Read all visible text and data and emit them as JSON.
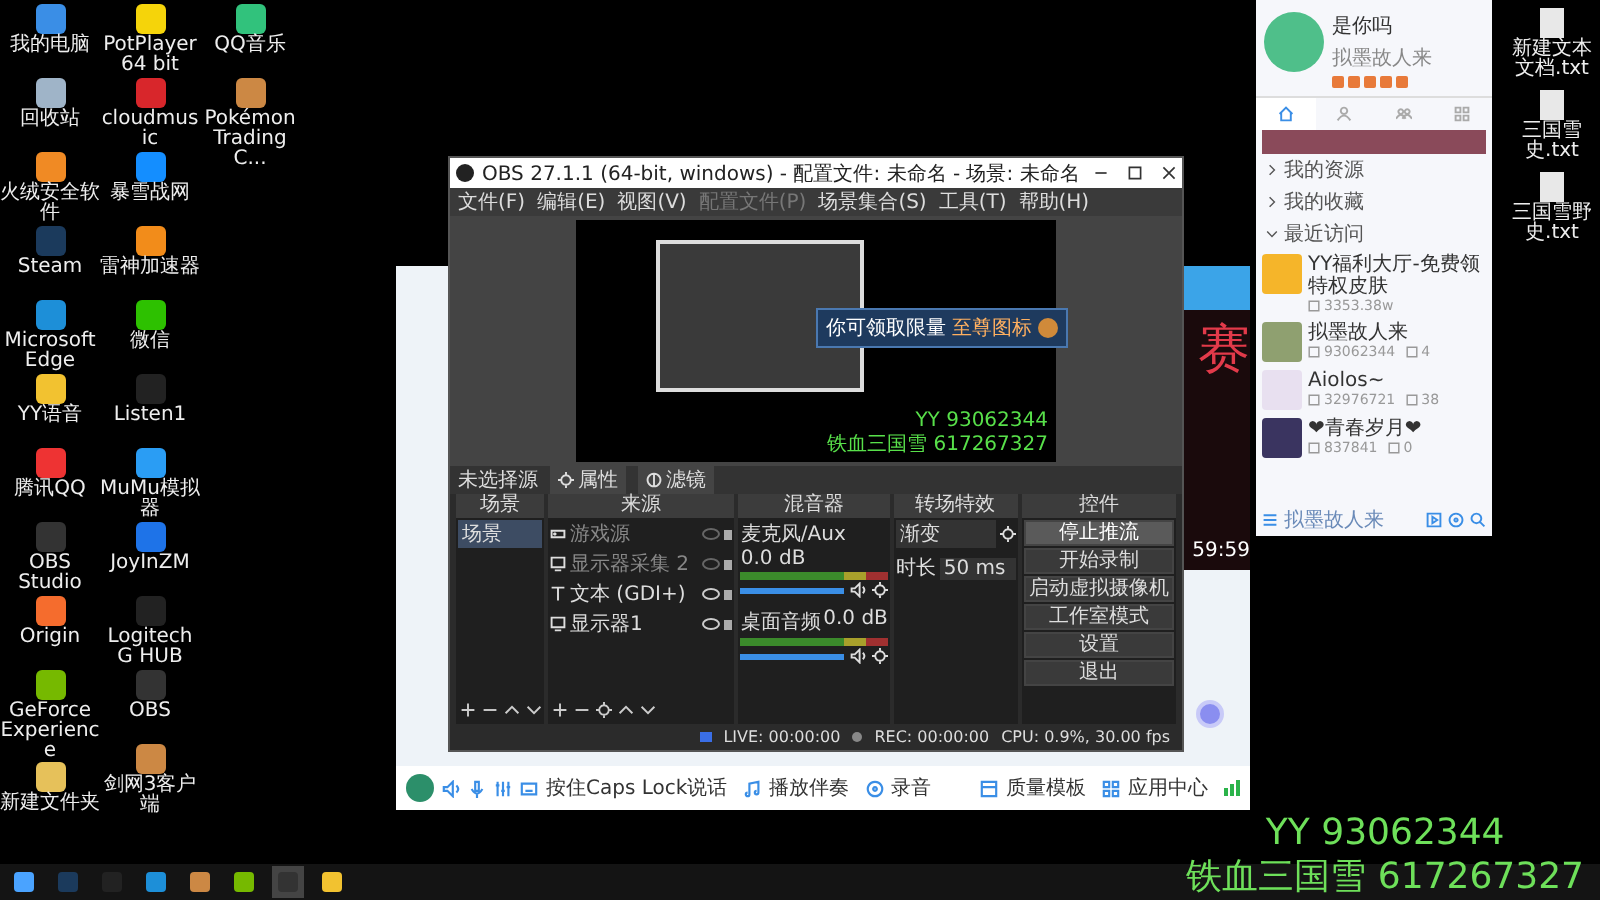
{
  "desktop": {
    "columns": [
      [
        {
          "label": "我的电脑",
          "kind": "computer"
        },
        {
          "label": "回收站",
          "kind": "trash"
        },
        {
          "label": "火绒安全软件",
          "kind": "shield"
        },
        {
          "label": "Steam",
          "kind": "steam"
        },
        {
          "label": "Microsoft Edge",
          "kind": "edge"
        },
        {
          "label": "YY语音",
          "kind": "yy"
        },
        {
          "label": "腾讯QQ",
          "kind": "qq"
        },
        {
          "label": "OBS Studio",
          "kind": "obs"
        },
        {
          "label": "Origin",
          "kind": "origin"
        },
        {
          "label": "GeForce Experience",
          "kind": "nvidia"
        },
        {
          "label": "新建文件夹",
          "kind": "folder"
        }
      ],
      [
        {
          "label": "PotPlayer 64 bit",
          "kind": "player"
        },
        {
          "label": "cloudmusic",
          "kind": "music"
        },
        {
          "label": "暴雪战网",
          "kind": "battlenet"
        },
        {
          "label": "雷神加速器",
          "kind": "boost"
        },
        {
          "label": "微信",
          "kind": "wechat"
        },
        {
          "label": "Listen1",
          "kind": "listen"
        },
        {
          "label": "MuMu模拟器",
          "kind": "mumu"
        },
        {
          "label": "JoyInZM",
          "kind": "gear"
        },
        {
          "label": "Logitech G HUB",
          "kind": "logitech"
        },
        {
          "label": "OBS",
          "kind": "obs"
        },
        {
          "label": "剑网3客户端",
          "kind": "game"
        }
      ],
      [
        {
          "label": "QQ音乐",
          "kind": "qqmusic"
        },
        {
          "label": "Pokémon Trading C...",
          "kind": "game"
        }
      ]
    ],
    "files": [
      {
        "label": "新建文本文档.txt"
      },
      {
        "label": "三国雪史.txt"
      },
      {
        "label": "三国雪野史.txt"
      }
    ]
  },
  "yy_window": {
    "big_char": "赛",
    "timer": "59:59",
    "toolbar": [
      {
        "label": "按住Caps Lock说话",
        "kind": "keyboard"
      },
      {
        "label": "播放伴奏",
        "kind": "music"
      },
      {
        "label": "录音",
        "kind": "record"
      }
    ],
    "toolbar_right": [
      {
        "label": "质量模板",
        "kind": "template"
      },
      {
        "label": "应用中心",
        "kind": "apps"
      }
    ]
  },
  "obs": {
    "title": "OBS 27.1.1 (64-bit, windows) - 配置文件: 未命名 - 场景: 未命名",
    "menu": [
      {
        "label": "文件(F)",
        "disabled": false
      },
      {
        "label": "编辑(E)",
        "disabled": false
      },
      {
        "label": "视图(V)",
        "disabled": false
      },
      {
        "label": "配置文件(P)",
        "disabled": true
      },
      {
        "label": "场景集合(S)",
        "disabled": false
      },
      {
        "label": "工具(T)",
        "disabled": false
      },
      {
        "label": "帮助(H)",
        "disabled": false
      }
    ],
    "preview": {
      "popup_text": "你可领取限量",
      "popup_highlight": "至尊图标",
      "yy_id": "YY 93062344",
      "caption": "铁血三国雪 617267327"
    },
    "source_toolbar": {
      "label": "未选择源",
      "buttons": [
        {
          "label": "属性",
          "kind": "gear"
        },
        {
          "label": "滤镜",
          "kind": "filter"
        }
      ]
    },
    "scenes": {
      "title": "场景",
      "items": [
        {
          "label": "场景",
          "selected": true
        }
      ]
    },
    "sources": {
      "title": "来源",
      "items": [
        {
          "label": "游戏源",
          "kind": "game",
          "visible": false
        },
        {
          "label": "显示器采集 2",
          "kind": "display",
          "visible": false
        },
        {
          "label": "文本 (GDI+)",
          "kind": "text",
          "visible": true
        },
        {
          "label": "显示器1",
          "kind": "display",
          "visible": true
        }
      ]
    },
    "mixer": {
      "title": "混音器",
      "channels": [
        {
          "name": "麦克风/Aux",
          "reading": "0.0 dB",
          "level": 1
        },
        {
          "name": "桌面音频",
          "reading": "0.0 dB",
          "level": 1
        }
      ]
    },
    "transitions": {
      "title": "转场特效",
      "selected": "渐变",
      "duration_label": "时长",
      "duration": "50 ms"
    },
    "controls": {
      "title": "控件",
      "buttons": [
        {
          "label": "停止推流",
          "hovered": true
        },
        {
          "label": "开始录制",
          "hovered": false
        },
        {
          "label": "启动虚拟摄像机",
          "hovered": false
        },
        {
          "label": "工作室模式",
          "hovered": false
        },
        {
          "label": "设置",
          "hovered": false
        },
        {
          "label": "退出",
          "hovered": false
        }
      ]
    },
    "status": {
      "live": "LIVE: 00:00:00",
      "rec": "REC: 00:00:00",
      "cpu": "CPU: 0.9%, 30.00 fps"
    }
  },
  "qq_panel": {
    "name": "是你吗",
    "signature": "拟墨故人来",
    "tabs": [
      {
        "kind": "home",
        "selected": true
      },
      {
        "kind": "person",
        "selected": false
      },
      {
        "kind": "people",
        "selected": false
      },
      {
        "kind": "apps",
        "selected": false
      }
    ],
    "sections": [
      {
        "label": "我的资源",
        "expanded": false
      },
      {
        "label": "我的收藏",
        "expanded": false
      },
      {
        "label": "最近访问",
        "expanded": true
      }
    ],
    "recent": [
      {
        "title": "YY福利大厅-免费领特权皮肤",
        "id": "3353.38w",
        "color": "#f5b52a"
      },
      {
        "title": "拟墨故人来",
        "id": "93062344",
        "count": "4",
        "color": "#8fa070"
      },
      {
        "title": "Aiolos~",
        "id": "32976721",
        "count": "38",
        "color": "#e8e0f0"
      },
      {
        "title": "❤青春岁月❤",
        "id": "837841",
        "count": "0",
        "color": "#3a3460"
      }
    ],
    "footer": "拟墨故人来"
  },
  "overlay": {
    "lines": [
      "YY 93062344",
      "铁血三国雪 617267327"
    ]
  },
  "taskbar": {
    "items": [
      {
        "kind": "start",
        "selected": false
      },
      {
        "kind": "steam",
        "selected": false
      },
      {
        "kind": "logitech",
        "selected": false
      },
      {
        "kind": "edge",
        "selected": false
      },
      {
        "kind": "game",
        "selected": false
      },
      {
        "kind": "nvidia",
        "selected": false
      },
      {
        "kind": "obs",
        "selected": true
      },
      {
        "kind": "yy",
        "selected": false
      }
    ]
  }
}
